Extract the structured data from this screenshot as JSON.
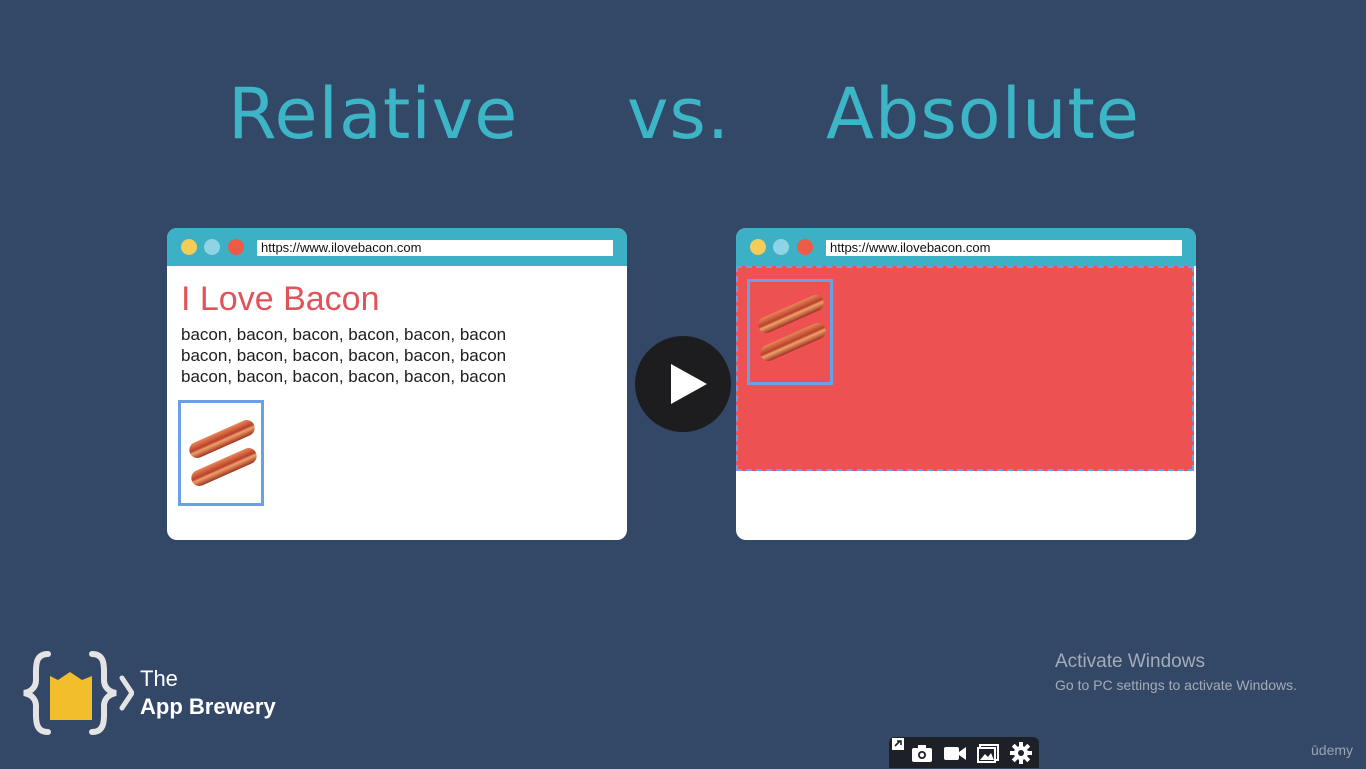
{
  "slide": {
    "title_left": "Relative",
    "title_mid": "vs.",
    "title_right": "Absolute",
    "left_browser": {
      "url": "https://www.ilovebacon.com",
      "heading": "I Love Bacon",
      "paragraph_lines": [
        "bacon, bacon, bacon, bacon, bacon, bacon",
        "bacon, bacon, bacon, bacon, bacon, bacon",
        "bacon, bacon, bacon, bacon, bacon, bacon"
      ]
    },
    "right_browser": {
      "url": "https://www.ilovebacon.com"
    }
  },
  "logo": {
    "line1": "The",
    "line2": "App Brewery"
  },
  "watermark": {
    "title": "Activate Windows",
    "subtitle": "Go to PC settings to activate Windows."
  },
  "toolbar_icons": [
    "pin-icon",
    "camera-icon",
    "video-icon",
    "image-icon",
    "gear-icon"
  ],
  "brand": "ūdemy",
  "colors": {
    "background": "#334766",
    "title": "#3cb5c7",
    "browser_bar": "#3cb0c5",
    "heading_red": "#e2525a",
    "absolute_area": "#ee5152",
    "outline_blue": "#6aa1e6"
  }
}
